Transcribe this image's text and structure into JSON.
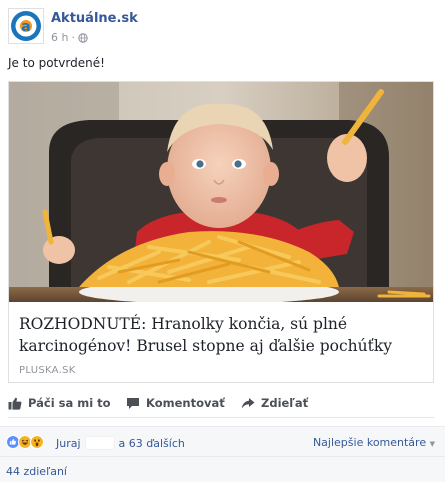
{
  "post": {
    "page_name": "Aktuálne.sk",
    "time": "6 h",
    "privacy_icon": "globe-icon",
    "text": "Je to potvrdené!"
  },
  "link_card": {
    "title": "ROZHODNUTÉ: Hranolky končia, sú plné karcinogénov! Brusel stopne aj ďalšie pochúťky",
    "source": "PLUSKA.SK"
  },
  "actions": {
    "like": "Páči sa mi to",
    "comment": "Komentovať",
    "share": "Zdieľať"
  },
  "reactions": {
    "icons": [
      "like-icon",
      "haha-icon",
      "wow-icon"
    ],
    "name": "Juraj",
    "others": "a 63 ďalších",
    "sort": "Najlepšie komentáre"
  },
  "shares": "44 zdieľaní",
  "colors": {
    "brand_blue": "#365899",
    "logo_blue": "#1b75bc",
    "muted": "#90949c"
  }
}
